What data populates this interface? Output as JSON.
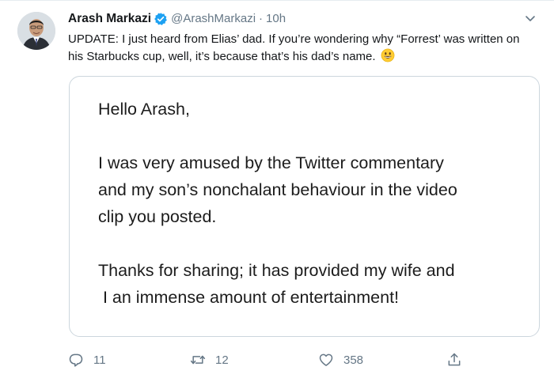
{
  "tweet": {
    "author_name": "Arash Markazi",
    "handle": "@ArashMarkazi",
    "separator": "·",
    "time": "10h",
    "verified": true,
    "text": "UPDATE: I just heard from Elias’ dad. If you’re wondering why “Forrest’ was written on his Starbucks cup, well, it’s because that’s his dad’s name.",
    "emoji": "grinning-face-emoji"
  },
  "letter": {
    "greeting": "Hello Arash,",
    "paragraph1_line1": "I was very amused by the Twitter commentary",
    "paragraph1_line2": "and my son’s nonchalant behaviour in the video",
    "paragraph1_line3": "clip you posted.",
    "paragraph2_line1": "Thanks for sharing; it has provided my wife and",
    "paragraph2_line2": " I an immense amount of entertainment!"
  },
  "actions": {
    "reply_count": "11",
    "retweet_count": "12",
    "like_count": "358"
  },
  "colors": {
    "verified_blue": "#1da1f2",
    "secondary_text": "#657786",
    "card_border": "#ccd6dd",
    "emoji_yellow": "#ffcc33"
  }
}
